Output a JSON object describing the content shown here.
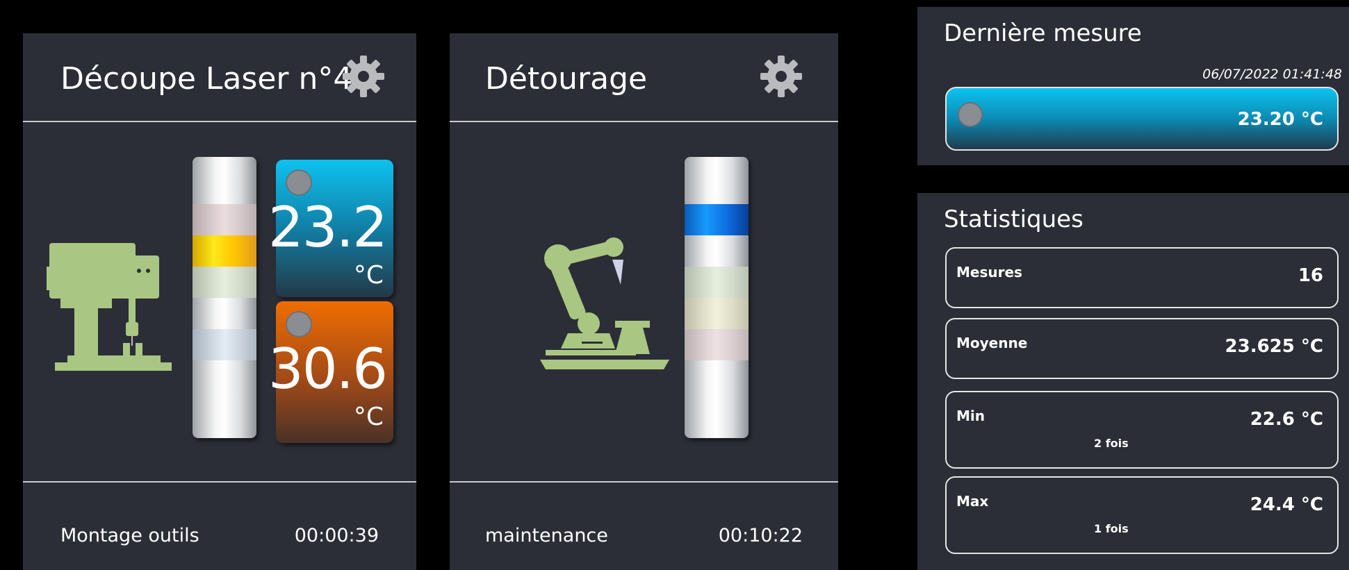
{
  "machines": [
    {
      "title": "Découpe Laser n°4",
      "status": "Montage outils",
      "time": "00:00:39",
      "icon": "drill-press-icon",
      "tower_segments": [
        "#d8c6c8",
        "#ffd100",
        "#d6dfcb",
        "#c9d6e2"
      ],
      "temperatures": [
        {
          "value": "23.2",
          "unit": "°C",
          "color_top": "#0dc3f0",
          "color_bottom": "#233947"
        },
        {
          "value": "30.6",
          "unit": "°C",
          "color_top": "#f06d00",
          "color_bottom": "#4a3127"
        }
      ]
    },
    {
      "title": "Détourage",
      "status": "maintenance",
      "time": "00:10:22",
      "icon": "robot-arm-icon",
      "tower_segments": [
        "#0f7ee8",
        "#dde6d6",
        "#e9e8cf",
        "#e4d5d6"
      ]
    }
  ],
  "last_measure": {
    "title": "Dernière mesure",
    "timestamp": "06/07/2022 01:41:48",
    "value": "23.20 °C"
  },
  "stats": {
    "title": "Statistiques",
    "rows": [
      {
        "label": "Mesures",
        "value": "16",
        "sub": ""
      },
      {
        "label": "Moyenne",
        "value": "23.625 °C",
        "sub": ""
      },
      {
        "label": "Min",
        "value": "22.6 °C",
        "sub": "2 fois"
      },
      {
        "label": "Max",
        "value": "24.4 °C",
        "sub": "1 fois"
      }
    ]
  },
  "colors": {
    "panel_bg": "#2b2e36",
    "background": "#000000",
    "accent_cyan": "#0dc3f0",
    "accent_orange": "#f06d00",
    "machine_icon": "#a9c682"
  }
}
